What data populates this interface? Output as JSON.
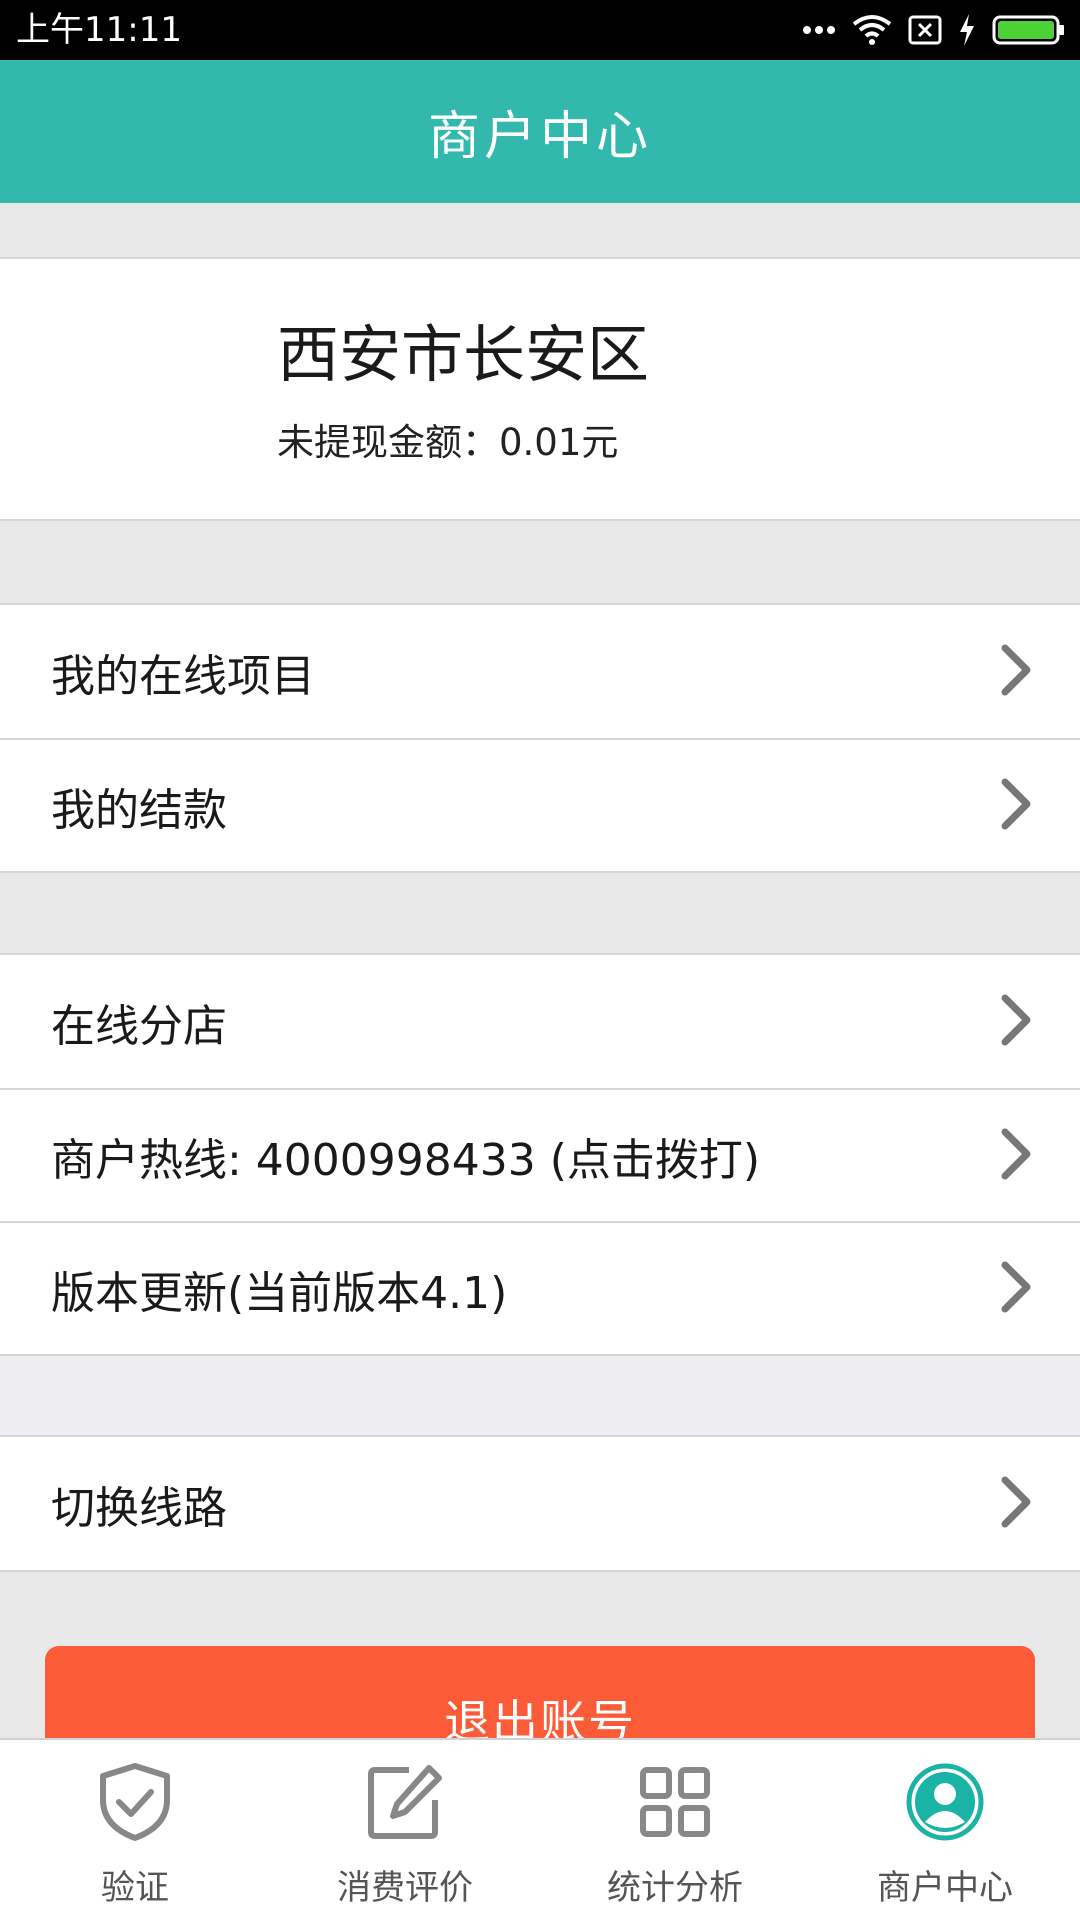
{
  "status_bar": {
    "time": "上午11:11"
  },
  "header": {
    "title": "商户中心"
  },
  "merchant": {
    "name": "西安市长安区",
    "balance": "未提现金额：0.01元"
  },
  "menu_groups": [
    {
      "items": [
        {
          "label": "我的在线项目"
        },
        {
          "label": "我的结款"
        }
      ]
    },
    {
      "items": [
        {
          "label": "在线分店"
        },
        {
          "label": "商户热线: 4000998433 (点击拨打)"
        },
        {
          "label": "版本更新(当前版本4.1)"
        }
      ]
    },
    {
      "items": [
        {
          "label": "切换线路"
        }
      ]
    }
  ],
  "logout": {
    "label": "退出账号"
  },
  "bottom_nav": {
    "items": [
      {
        "label": "验证",
        "icon": "shield-check-icon",
        "active": false
      },
      {
        "label": "消费评价",
        "icon": "edit-icon",
        "active": false
      },
      {
        "label": "统计分析",
        "icon": "grid-icon",
        "active": false
      },
      {
        "label": "商户中心",
        "icon": "user-icon",
        "active": true
      }
    ]
  },
  "colors": {
    "header": "#33b8ad",
    "logout": "#fb5c37",
    "active_icon": "#1ab3a6",
    "inactive_icon": "#888888",
    "battery": "#4cd137"
  }
}
